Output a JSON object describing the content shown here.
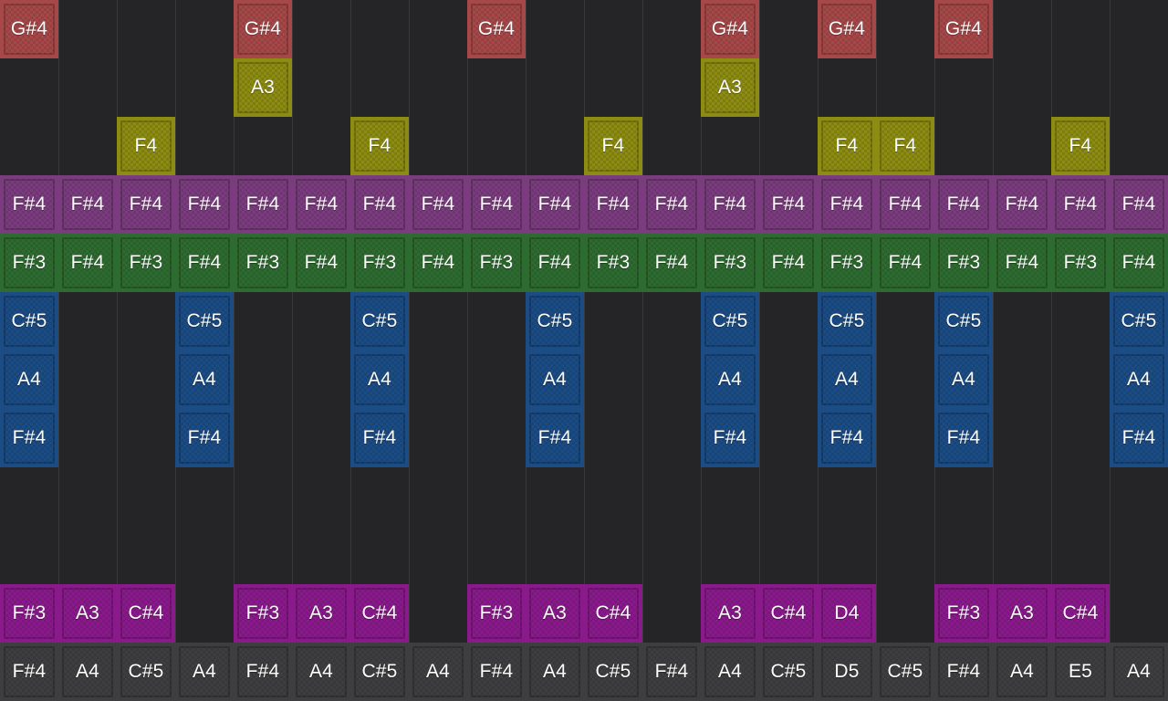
{
  "grid": {
    "columns": 20,
    "rows": 12
  },
  "tracks": [
    {
      "id": "red",
      "color": "#a74848",
      "cells": [
        {
          "col": 0,
          "row": 0,
          "label": "G#4"
        },
        {
          "col": 4,
          "row": 0,
          "label": "G#4"
        },
        {
          "col": 8,
          "row": 0,
          "label": "G#4"
        },
        {
          "col": 12,
          "row": 0,
          "label": "G#4"
        },
        {
          "col": 14,
          "row": 0,
          "label": "G#4"
        },
        {
          "col": 16,
          "row": 0,
          "label": "G#4"
        }
      ]
    },
    {
      "id": "olive-a",
      "color": "#8c8c12",
      "cells": [
        {
          "col": 4,
          "row": 1,
          "label": "A3"
        },
        {
          "col": 12,
          "row": 1,
          "label": "A3"
        }
      ]
    },
    {
      "id": "olive-f",
      "color": "#8c8c12",
      "cells": [
        {
          "col": 2,
          "row": 2,
          "label": "F4"
        },
        {
          "col": 6,
          "row": 2,
          "label": "F4"
        },
        {
          "col": 10,
          "row": 2,
          "label": "F4"
        },
        {
          "col": 14,
          "row": 2,
          "label": "F4"
        },
        {
          "col": 15,
          "row": 2,
          "label": "F4"
        },
        {
          "col": 18,
          "row": 2,
          "label": "F4"
        }
      ]
    },
    {
      "id": "purple",
      "color": "#7a3c7e",
      "cells": [
        {
          "col": 0,
          "row": 3,
          "label": "F#4"
        },
        {
          "col": 1,
          "row": 3,
          "label": "F#4"
        },
        {
          "col": 2,
          "row": 3,
          "label": "F#4"
        },
        {
          "col": 3,
          "row": 3,
          "label": "F#4"
        },
        {
          "col": 4,
          "row": 3,
          "label": "F#4"
        },
        {
          "col": 5,
          "row": 3,
          "label": "F#4"
        },
        {
          "col": 6,
          "row": 3,
          "label": "F#4"
        },
        {
          "col": 7,
          "row": 3,
          "label": "F#4"
        },
        {
          "col": 8,
          "row": 3,
          "label": "F#4"
        },
        {
          "col": 9,
          "row": 3,
          "label": "F#4"
        },
        {
          "col": 10,
          "row": 3,
          "label": "F#4"
        },
        {
          "col": 11,
          "row": 3,
          "label": "F#4"
        },
        {
          "col": 12,
          "row": 3,
          "label": "F#4"
        },
        {
          "col": 13,
          "row": 3,
          "label": "F#4"
        },
        {
          "col": 14,
          "row": 3,
          "label": "F#4"
        },
        {
          "col": 15,
          "row": 3,
          "label": "F#4"
        },
        {
          "col": 16,
          "row": 3,
          "label": "F#4"
        },
        {
          "col": 17,
          "row": 3,
          "label": "F#4"
        },
        {
          "col": 18,
          "row": 3,
          "label": "F#4"
        },
        {
          "col": 19,
          "row": 3,
          "label": "F#4"
        }
      ]
    },
    {
      "id": "green",
      "color": "#2e6b30",
      "cells": [
        {
          "col": 0,
          "row": 4,
          "label": "F#3"
        },
        {
          "col": 1,
          "row": 4,
          "label": "F#4"
        },
        {
          "col": 2,
          "row": 4,
          "label": "F#3"
        },
        {
          "col": 3,
          "row": 4,
          "label": "F#4"
        },
        {
          "col": 4,
          "row": 4,
          "label": "F#3"
        },
        {
          "col": 5,
          "row": 4,
          "label": "F#4"
        },
        {
          "col": 6,
          "row": 4,
          "label": "F#3"
        },
        {
          "col": 7,
          "row": 4,
          "label": "F#4"
        },
        {
          "col": 8,
          "row": 4,
          "label": "F#3"
        },
        {
          "col": 9,
          "row": 4,
          "label": "F#4"
        },
        {
          "col": 10,
          "row": 4,
          "label": "F#3"
        },
        {
          "col": 11,
          "row": 4,
          "label": "F#4"
        },
        {
          "col": 12,
          "row": 4,
          "label": "F#3"
        },
        {
          "col": 13,
          "row": 4,
          "label": "F#4"
        },
        {
          "col": 14,
          "row": 4,
          "label": "F#3"
        },
        {
          "col": 15,
          "row": 4,
          "label": "F#4"
        },
        {
          "col": 16,
          "row": 4,
          "label": "F#3"
        },
        {
          "col": 17,
          "row": 4,
          "label": "F#4"
        },
        {
          "col": 18,
          "row": 4,
          "label": "F#3"
        },
        {
          "col": 19,
          "row": 4,
          "label": "F#4"
        }
      ]
    },
    {
      "id": "blue",
      "color": "#1c4c84",
      "cells": [
        {
          "col": 0,
          "row": 5,
          "label": "C#5"
        },
        {
          "col": 0,
          "row": 6,
          "label": "A4"
        },
        {
          "col": 0,
          "row": 7,
          "label": "F#4"
        },
        {
          "col": 3,
          "row": 5,
          "label": "C#5"
        },
        {
          "col": 3,
          "row": 6,
          "label": "A4"
        },
        {
          "col": 3,
          "row": 7,
          "label": "F#4"
        },
        {
          "col": 6,
          "row": 5,
          "label": "C#5"
        },
        {
          "col": 6,
          "row": 6,
          "label": "A4"
        },
        {
          "col": 6,
          "row": 7,
          "label": "F#4"
        },
        {
          "col": 9,
          "row": 5,
          "label": "C#5"
        },
        {
          "col": 9,
          "row": 6,
          "label": "A4"
        },
        {
          "col": 9,
          "row": 7,
          "label": "F#4"
        },
        {
          "col": 12,
          "row": 5,
          "label": "C#5"
        },
        {
          "col": 12,
          "row": 6,
          "label": "A4"
        },
        {
          "col": 12,
          "row": 7,
          "label": "F#4"
        },
        {
          "col": 14,
          "row": 5,
          "label": "C#5"
        },
        {
          "col": 14,
          "row": 6,
          "label": "A4"
        },
        {
          "col": 14,
          "row": 7,
          "label": "F#4"
        },
        {
          "col": 16,
          "row": 5,
          "label": "C#5"
        },
        {
          "col": 16,
          "row": 6,
          "label": "A4"
        },
        {
          "col": 16,
          "row": 7,
          "label": "F#4"
        },
        {
          "col": 19,
          "row": 5,
          "label": "C#5"
        },
        {
          "col": 19,
          "row": 6,
          "label": "A4"
        },
        {
          "col": 19,
          "row": 7,
          "label": "F#4"
        }
      ]
    },
    {
      "id": "magenta",
      "color": "#8a1a8c",
      "cells": [
        {
          "col": 0,
          "row": 10,
          "label": "F#3"
        },
        {
          "col": 1,
          "row": 10,
          "label": "A3"
        },
        {
          "col": 2,
          "row": 10,
          "label": "C#4"
        },
        {
          "col": 4,
          "row": 10,
          "label": "F#3"
        },
        {
          "col": 5,
          "row": 10,
          "label": "A3"
        },
        {
          "col": 6,
          "row": 10,
          "label": "C#4"
        },
        {
          "col": 8,
          "row": 10,
          "label": "F#3"
        },
        {
          "col": 9,
          "row": 10,
          "label": "A3"
        },
        {
          "col": 10,
          "row": 10,
          "label": "C#4"
        },
        {
          "col": 12,
          "row": 10,
          "label": "A3"
        },
        {
          "col": 13,
          "row": 10,
          "label": "C#4"
        },
        {
          "col": 14,
          "row": 10,
          "label": "D4"
        },
        {
          "col": 16,
          "row": 10,
          "label": "F#3"
        },
        {
          "col": 17,
          "row": 10,
          "label": "A3"
        },
        {
          "col": 18,
          "row": 10,
          "label": "C#4"
        }
      ]
    },
    {
      "id": "gray",
      "color": "#3e3e40",
      "cells": [
        {
          "col": 0,
          "row": 11,
          "label": "F#4"
        },
        {
          "col": 1,
          "row": 11,
          "label": "A4"
        },
        {
          "col": 2,
          "row": 11,
          "label": "C#5"
        },
        {
          "col": 3,
          "row": 11,
          "label": "A4"
        },
        {
          "col": 4,
          "row": 11,
          "label": "F#4"
        },
        {
          "col": 5,
          "row": 11,
          "label": "A4"
        },
        {
          "col": 6,
          "row": 11,
          "label": "C#5"
        },
        {
          "col": 7,
          "row": 11,
          "label": "A4"
        },
        {
          "col": 8,
          "row": 11,
          "label": "F#4"
        },
        {
          "col": 9,
          "row": 11,
          "label": "A4"
        },
        {
          "col": 10,
          "row": 11,
          "label": "C#5"
        },
        {
          "col": 11,
          "row": 11,
          "label": "F#4"
        },
        {
          "col": 12,
          "row": 11,
          "label": "A4"
        },
        {
          "col": 13,
          "row": 11,
          "label": "C#5"
        },
        {
          "col": 14,
          "row": 11,
          "label": "D5"
        },
        {
          "col": 15,
          "row": 11,
          "label": "C#5"
        },
        {
          "col": 16,
          "row": 11,
          "label": "F#4"
        },
        {
          "col": 17,
          "row": 11,
          "label": "A4"
        },
        {
          "col": 18,
          "row": 11,
          "label": "E5"
        },
        {
          "col": 19,
          "row": 11,
          "label": "A4"
        }
      ]
    }
  ]
}
